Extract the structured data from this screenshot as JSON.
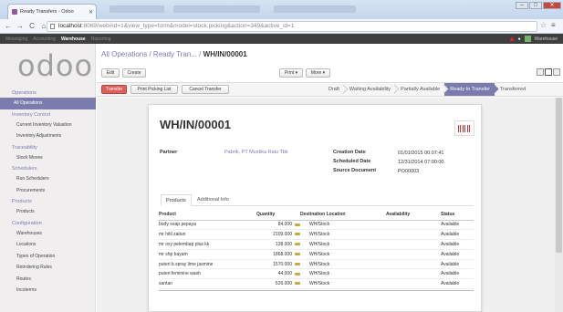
{
  "browser": {
    "tab_title": "Ready Transfers - Odoo",
    "url_host": "localhost",
    "url_rest": ":8069/web#id=1&view_type=form&model=stock.picking&action=349&active_id=1"
  },
  "topnav": {
    "items": [
      "Messaging",
      "Accounting",
      "Warehouse",
      "Reporting"
    ],
    "active": "Warehouse",
    "user": "Warehouse"
  },
  "sidebar": {
    "sections": [
      {
        "title": "Operations",
        "items": [
          {
            "label": "All Operations",
            "selected": true
          }
        ]
      },
      {
        "title": "Inventory Control",
        "items": [
          {
            "label": "Current Inventory Valuation"
          },
          {
            "label": "Inventory Adjustments"
          }
        ]
      },
      {
        "title": "Traceability",
        "items": [
          {
            "label": "Stock Moves"
          }
        ]
      },
      {
        "title": "Schedulers",
        "items": [
          {
            "label": "Run Schedulers"
          },
          {
            "label": "Procurements"
          }
        ]
      },
      {
        "title": "Products",
        "items": [
          {
            "label": "Products"
          }
        ]
      },
      {
        "title": "Configuration",
        "items": [
          {
            "label": "Warehouses"
          },
          {
            "label": "Locations"
          },
          {
            "label": "Types of Operation"
          },
          {
            "label": "Reordering Rules"
          },
          {
            "label": "Routes"
          },
          {
            "label": "Incoterms"
          }
        ]
      }
    ]
  },
  "breadcrumb": {
    "parent": "All Operations / Ready Tran...",
    "separator": "/",
    "current": "WH/IN/00001"
  },
  "toolbar": {
    "edit": "Edit",
    "create": "Create",
    "print": "Print ▾",
    "more": "More ▾"
  },
  "actions": {
    "transfer": "Transfer",
    "print_picking": "Print Picking List",
    "cancel": "Cancel Transfer"
  },
  "status_steps": [
    "Draft",
    "Waiting Availability",
    "Partially Available",
    "Ready to Transfer",
    "Transferred"
  ],
  "status_current": "Ready to Transfer",
  "form": {
    "title": "WH/IN/00001",
    "partner_label": "Partner",
    "partner_value": "Pabrik, PT Mustika Ratu Tbk",
    "creation_date_label": "Creation Date",
    "creation_date_value": "01/01/2015 00:07:41",
    "scheduled_date_label": "Scheduled Date",
    "scheduled_date_value": "12/31/2014 07:00:00",
    "source_document_label": "Source Document",
    "source_document_value": "PO00003",
    "tabs": [
      "Products",
      "Additional Info"
    ]
  },
  "table": {
    "headers": [
      "Product",
      "Quantity",
      "Destination Location",
      "Availability",
      "Status"
    ],
    "rows": [
      {
        "product": "body soap pepaya",
        "qty": "84.000",
        "dest": "WH/Stock",
        "avail": "",
        "status": "Available"
      },
      {
        "product": "mr hitil zaitun",
        "qty": "2109.000",
        "dest": "WH/Stock",
        "avail": "",
        "status": "Available"
      },
      {
        "product": "mr oxy pelembap plus kk",
        "qty": "138.000",
        "dest": "WH/Stock",
        "avail": "",
        "status": "Available"
      },
      {
        "product": "mr shp bayam",
        "qty": "1868.000",
        "dest": "WH/Stock",
        "avail": "",
        "status": "Available"
      },
      {
        "product": "puteri b.spray lime jasmine",
        "qty": "1570.000",
        "dest": "WH/Stock",
        "avail": "",
        "status": "Available"
      },
      {
        "product": "puteri feminine wash",
        "qty": "44.000",
        "dest": "WH/Stock",
        "avail": "",
        "status": "Available"
      },
      {
        "product": "santan",
        "qty": "526.000",
        "dest": "WH/Stock",
        "avail": "",
        "status": "Available"
      }
    ]
  },
  "colors": {
    "accent": "#7c7bad",
    "action_red": "#dc5f59"
  }
}
